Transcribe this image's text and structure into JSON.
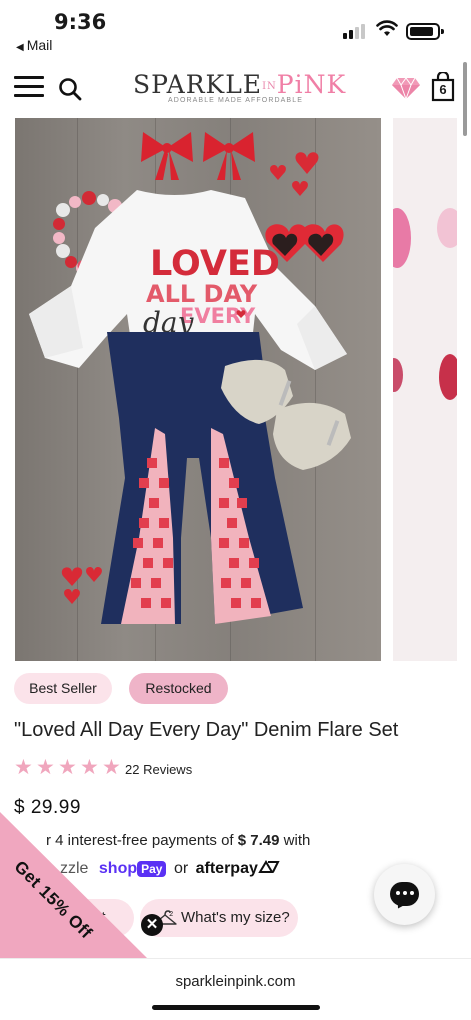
{
  "status_bar": {
    "time": "9:36",
    "back_app": "Mail"
  },
  "header": {
    "logo_sparkle": "SPARKLE",
    "logo_in": "IN",
    "logo_pink": "PiNK",
    "logo_tagline": "ADORABLE MADE AFFORDABLE",
    "cart_count": "6"
  },
  "product_image": {
    "shirt_text_line1": "LOVED",
    "shirt_text_line2": "ALL DAY",
    "shirt_text_line3": "EVERY",
    "shirt_text_line4": "day"
  },
  "badges": {
    "best_seller": "Best Seller",
    "restocked": "Restocked"
  },
  "product": {
    "title": "\"Loved All Day Every Day\" Denim Flare Set",
    "rating_stars": 5,
    "reviews": "22 Reviews",
    "price": "$ 29.99",
    "payments_prefix": "r 4 interest-free payments of",
    "payments_amount": "$ 7.49",
    "payments_suffix": "with",
    "sezzle": "zzle",
    "shoppay_shop": "shop",
    "shoppay_pay": "Pay",
    "or": "or",
    "afterpay": "afterpay"
  },
  "buttons": {
    "add_to_cart": "art",
    "size_guide": "What's my size?"
  },
  "promo": {
    "label": "Get 15% Off",
    "close": "✕"
  },
  "browser": {
    "url": "sparkleinpink.com"
  },
  "colors": {
    "brand_pink": "#f07fa6",
    "badge_light": "#fbe3ea",
    "badge_dark": "#efb4c8",
    "star": "#f0a6bd"
  }
}
